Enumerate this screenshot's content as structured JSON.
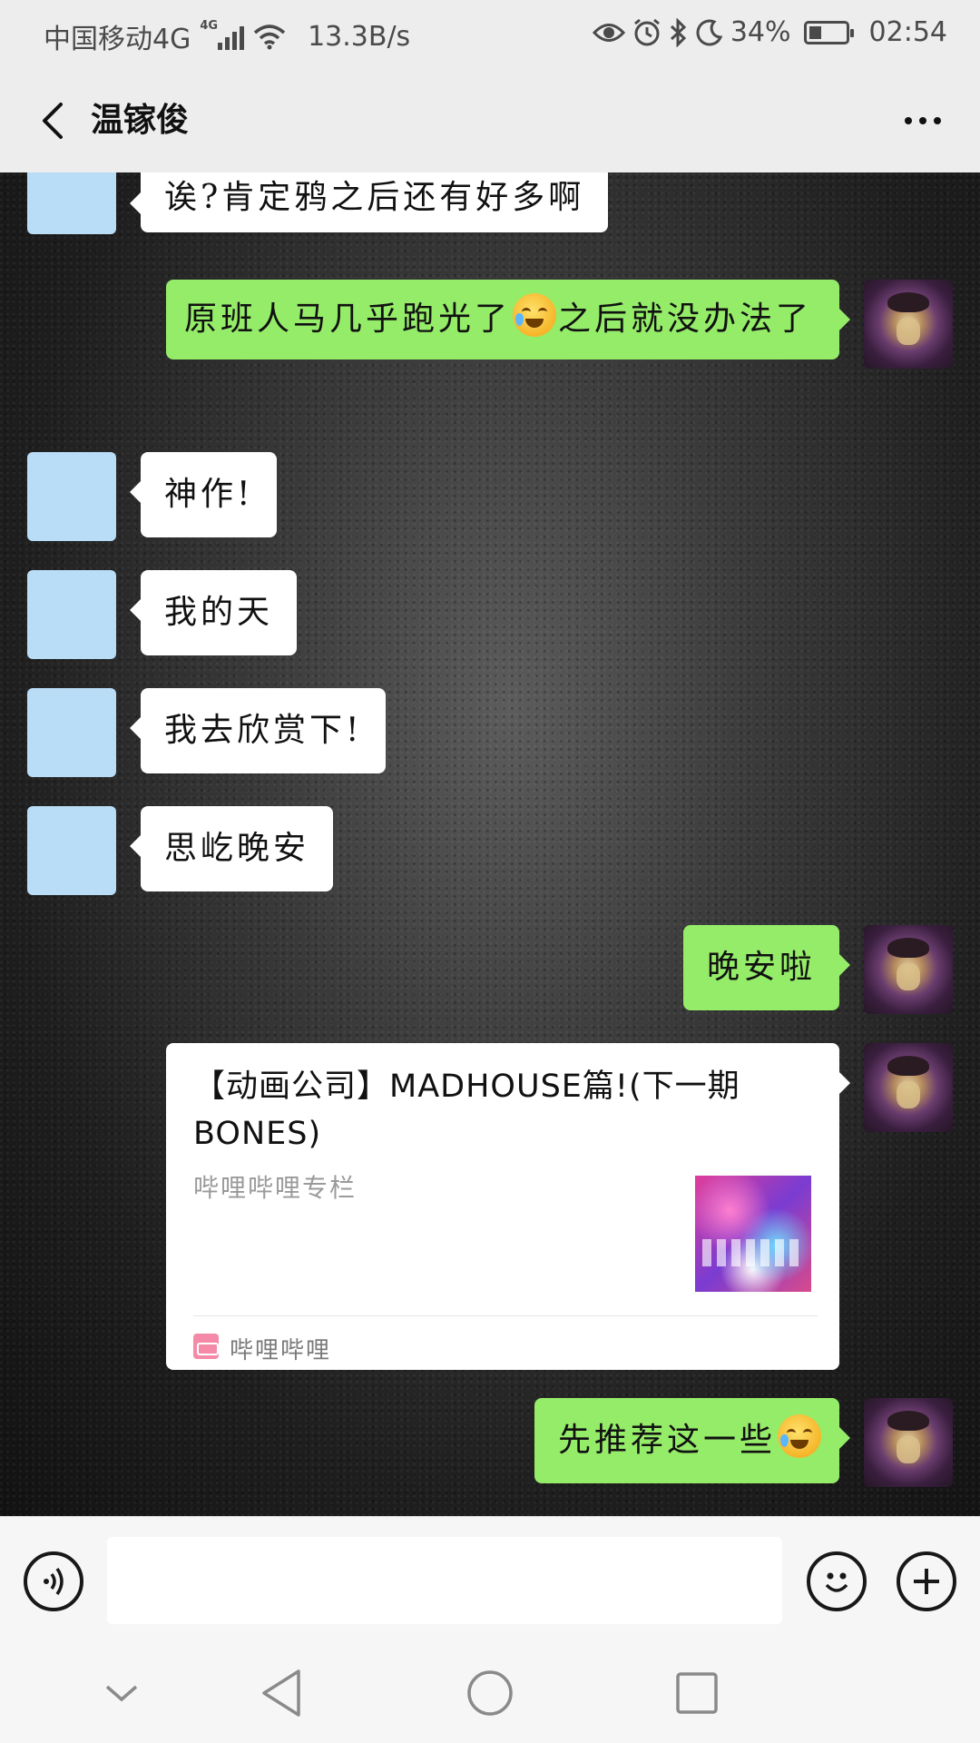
{
  "status_bar": {
    "carrier": "中国移动4G",
    "network_badge": "4G",
    "speed": "13.3B/s",
    "battery_percent": "34%",
    "battery_level": 0.34,
    "time": "02:54",
    "icons": [
      "signal-icon",
      "wifi-icon",
      "eye-icon",
      "alarm-icon",
      "bluetooth-icon",
      "moon-icon",
      "battery-icon"
    ]
  },
  "header": {
    "title": "温镓俊",
    "back_icon": "back-arrow-icon",
    "more_icon": "more-dots-icon"
  },
  "messages": [
    {
      "from": "other",
      "text": "诶?肯定鸦之后还有好多啊"
    },
    {
      "from": "me",
      "text_before": "原班人马几乎跑光了",
      "emoji": "laugh-cry-emoji",
      "text_after": "之后就没办法了"
    },
    {
      "from": "other",
      "text": "神作!"
    },
    {
      "from": "other",
      "text": "我的天"
    },
    {
      "from": "other",
      "text": "我去欣赏下!"
    },
    {
      "from": "other",
      "text": "思屹晚安"
    },
    {
      "from": "me",
      "text": "晚安啦"
    },
    {
      "from": "me",
      "type": "link_card",
      "title": "【动画公司】MADHOUSE篇!(下一期BONES)",
      "description": "哔哩哔哩专栏",
      "source": "哔哩哔哩"
    },
    {
      "from": "me",
      "text": "先推荐这一些",
      "emoji": "laugh-cry-emoji"
    }
  ],
  "input_bar": {
    "value": "",
    "voice_icon": "voice-icon",
    "emoji_icon": "emoji-icon",
    "plus_icon": "plus-icon"
  },
  "nav_bar": {
    "icons": [
      "collapse-icon",
      "nav-back-icon",
      "home-icon",
      "recents-icon"
    ]
  },
  "colors": {
    "my_bubble": "#95ec69",
    "other_bubble": "#ffffff",
    "other_avatar": "#b9dcf7",
    "bar_bg": "#ededed"
  }
}
